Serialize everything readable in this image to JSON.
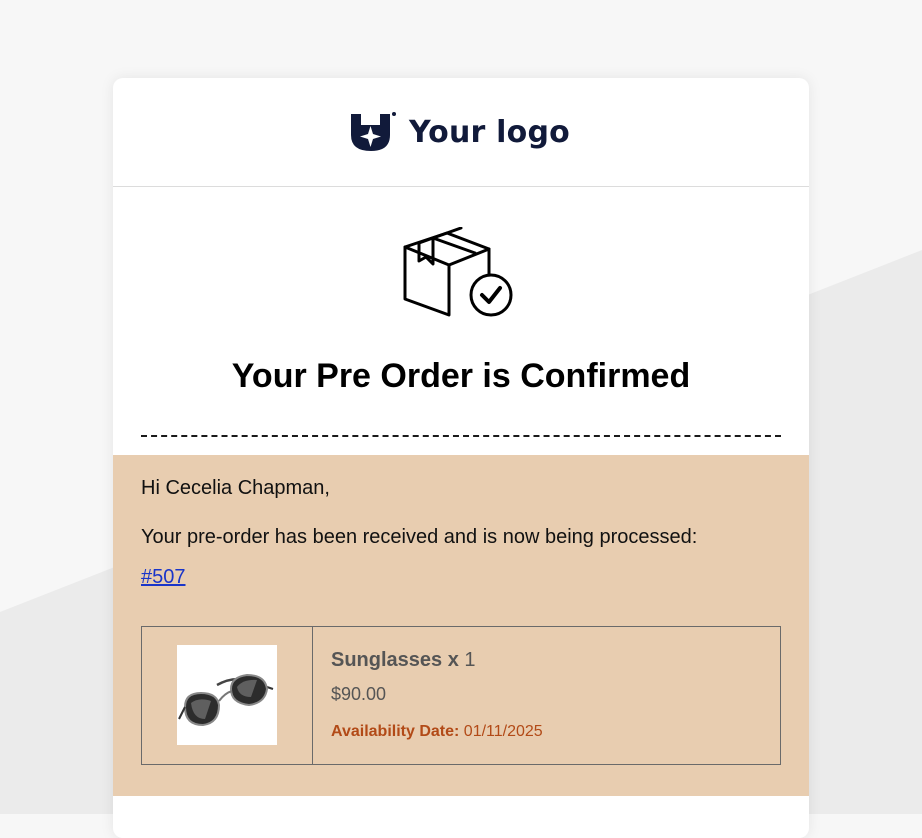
{
  "logo": {
    "text": "Your logo"
  },
  "hero": {
    "title": "Your Pre Order is Confirmed"
  },
  "message": {
    "greeting": "Hi Cecelia Chapman,",
    "body": "Your pre-order has been received and is now being processed:",
    "order_number": "#507"
  },
  "product": {
    "name": "Sunglasses x",
    "quantity": "1",
    "price": "$90.00",
    "availability_label": "Availability Date:",
    "availability_date": "01/11/2025"
  },
  "colors": {
    "brand_navy": "#111a3a",
    "content_bg": "#e8cdb0",
    "link": "#1a35c9",
    "availability": "#b24a17"
  },
  "icons": {
    "logo": "shield-star-icon",
    "hero": "package-check-icon",
    "product": "sunglasses-image"
  }
}
